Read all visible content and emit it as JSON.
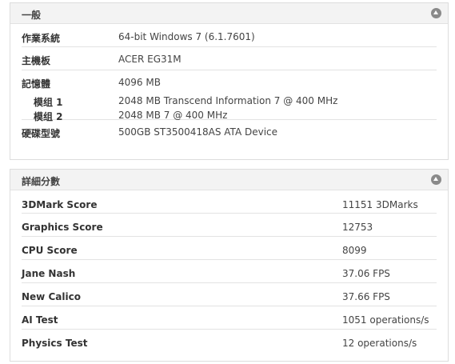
{
  "general": {
    "title": "一般",
    "os_label": "作業系統",
    "os_value": "64-bit Windows 7 (6.1.7601)",
    "mobo_label": "主機板",
    "mobo_value": "ACER EG31M",
    "memory_label": "記憶體",
    "memory_value": "4096 MB",
    "modules": [
      {
        "label": "模组 1",
        "value": "2048 MB Transcend Information 7 @ 400 MHz"
      },
      {
        "label": "模组 2",
        "value": "2048 MB 7 @ 400 MHz"
      }
    ],
    "disk_label": "硬碟型號",
    "disk_value": "500GB ST3500418AS ATA Device"
  },
  "scores": {
    "title": "詳細分數",
    "rows": [
      {
        "label": "3DMark Score",
        "value": "11151 3DMarks"
      },
      {
        "label": "Graphics Score",
        "value": "12753"
      },
      {
        "label": "CPU Score",
        "value": "8099"
      },
      {
        "label": "Jane Nash",
        "value": "37.06 FPS"
      },
      {
        "label": "New Calico",
        "value": "37.66 FPS"
      },
      {
        "label": "AI Test",
        "value": "1051 operations/s"
      },
      {
        "label": "Physics Test",
        "value": "12 operations/s"
      }
    ]
  }
}
